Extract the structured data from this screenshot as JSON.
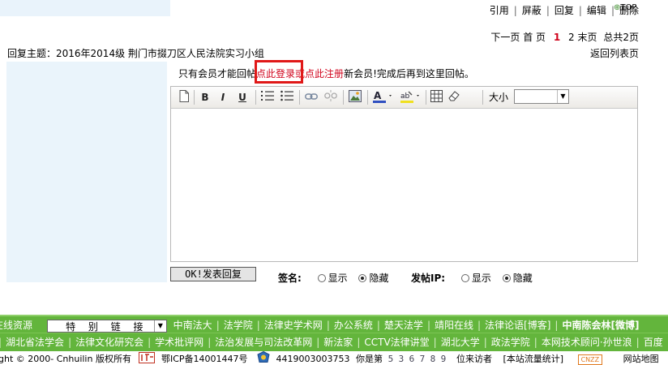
{
  "top_actions": [
    "引用",
    "屏蔽",
    "回复",
    "编辑",
    "删除"
  ],
  "top_link": "TOP",
  "pager": {
    "next": "下一页",
    "first": "首 页",
    "current": "1",
    "page2": "2",
    "last": "末页",
    "total": "总共2页"
  },
  "reply_title": "回复主题：2016年2014级 荆门市掇刀区人民法院实习小组",
  "back_list": "返回列表页",
  "notice": {
    "prefix": "只有会员才能回帖",
    "login": "点此登录",
    "register_prefix": "或",
    "register": "点此注册",
    "suffix": "新会员!完成后再到这里回帖。"
  },
  "editor": {
    "size_label": "大小",
    "size_value": ""
  },
  "submit_label": "OK!发表回复",
  "signature": {
    "label": "签名:",
    "show": "显示",
    "hide": "隐藏"
  },
  "ip": {
    "label": "发帖IP:",
    "show": "显示",
    "hide": "隐藏"
  },
  "links_row1": {
    "lead": "在线资源",
    "special": "特 别 链 接",
    "items": [
      "中南法大",
      "法学院",
      "法律史学术网",
      "办公系统",
      "楚天法学",
      "靖阳在线",
      "法律论语[博客]",
      "中南陈会林[微博]"
    ]
  },
  "links_row2": {
    "items": [
      "湖北省法学会",
      "法律文化研究会",
      "学术批评网",
      "法治发展与司法改革网",
      "新法家",
      "CCTV法律讲堂",
      "湖北大学",
      "政法学院",
      "本网技术顾问·孙世浪",
      "百度"
    ]
  },
  "footer": {
    "copyright": "ght © 2000- Cnhuilin 版权所有",
    "icp": "鄂ICP备14001447号",
    "police": "4419003003753",
    "visitor_prefix": "你是第",
    "visitor_digits": [
      "5",
      "3",
      "6",
      "7",
      "8",
      "9"
    ],
    "visitor_suffix": "位来访者",
    "stats": "[本站流量统计]",
    "cnzz": "CNZZ",
    "trail": "网站地图"
  }
}
